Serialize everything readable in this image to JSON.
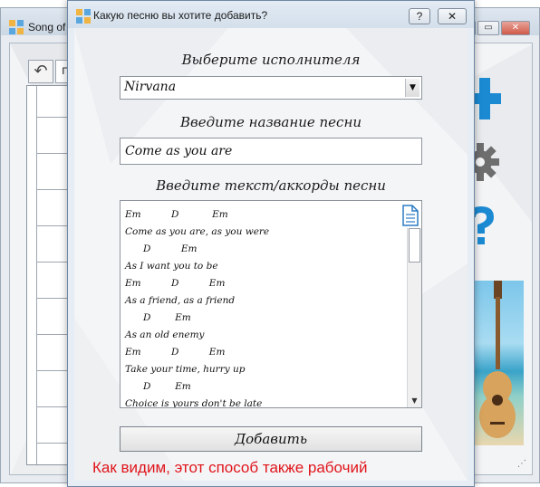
{
  "background_window": {
    "title": "Song of",
    "minimize_label": "—",
    "maximize_label": "▭",
    "close_label": "✕",
    "back_glyph": "↶",
    "search_fragment": "п"
  },
  "dialog": {
    "title": "Какую песню вы хотите добавить?",
    "help_label": "?",
    "close_label": "✕",
    "artist_label": "Выберите исполнителя",
    "artist_value": "Nirvana",
    "song_label": "Введите название песни",
    "song_value": "Come as you are",
    "lyrics_label": "Введите текст/аккорды песни",
    "lyrics_lines": [
      "Em          D           Em",
      "Come as you are, as you were",
      "      D          Em",
      "As I want you to be",
      "Em          D          Em",
      "As a friend, as a friend",
      "      D        Em",
      "As an old enemy",
      "Em          D          Em",
      "Take your time, hurry up",
      "      D        Em",
      "Choice is yours don't be late"
    ],
    "add_button": "Добавить",
    "caption": "Как видим, этот способ также рабочий"
  },
  "colors": {
    "caption": "#e0151b",
    "side_blue": "#1b8ad3",
    "side_gray": "#6e6e6e"
  }
}
